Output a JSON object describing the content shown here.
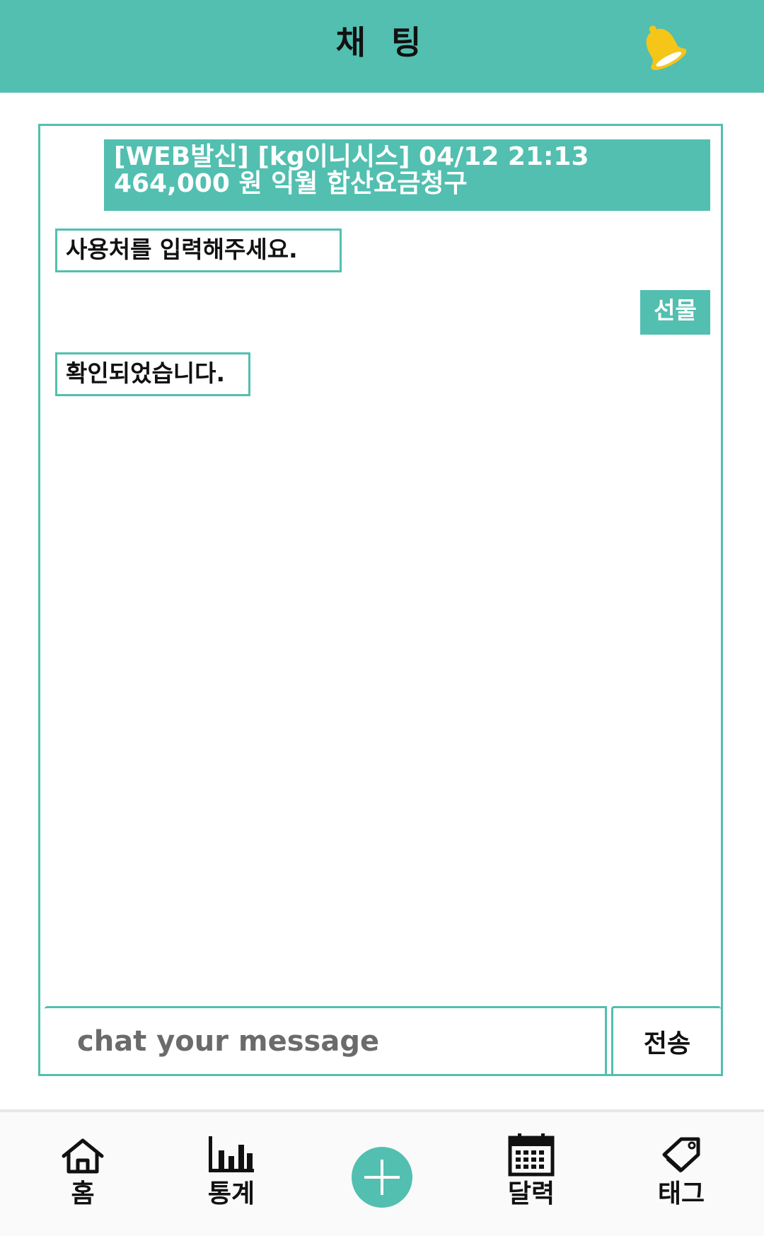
{
  "header": {
    "title": "채 팅"
  },
  "chat": {
    "messages": [
      {
        "side": "left",
        "style": "filled",
        "text": "[WEB발신] [kg이니시스] 04/12 21:13 464,000 원 익월 합산요금청구"
      },
      {
        "side": "left",
        "style": "outlined",
        "text": "사용처를 입력해주세요."
      },
      {
        "side": "right",
        "style": "filled",
        "text": "선물"
      },
      {
        "side": "left",
        "style": "outlined",
        "text": "확인되었습니다."
      }
    ],
    "input": {
      "placeholder": "chat your message",
      "value": ""
    },
    "send_label": "전송"
  },
  "nav": {
    "items": [
      {
        "label": "홈",
        "icon": "home-icon"
      },
      {
        "label": "통계",
        "icon": "bar-chart-icon"
      },
      {
        "label": "",
        "icon": "plus-icon"
      },
      {
        "label": "달력",
        "icon": "calendar-icon"
      },
      {
        "label": "태그",
        "icon": "tag-icon"
      }
    ]
  },
  "colors": {
    "accent": "#52bfb0",
    "bell": "#f5c518",
    "text": "#111111",
    "placeholder": "#6b6b6b",
    "nav_background": "#fafafa"
  }
}
